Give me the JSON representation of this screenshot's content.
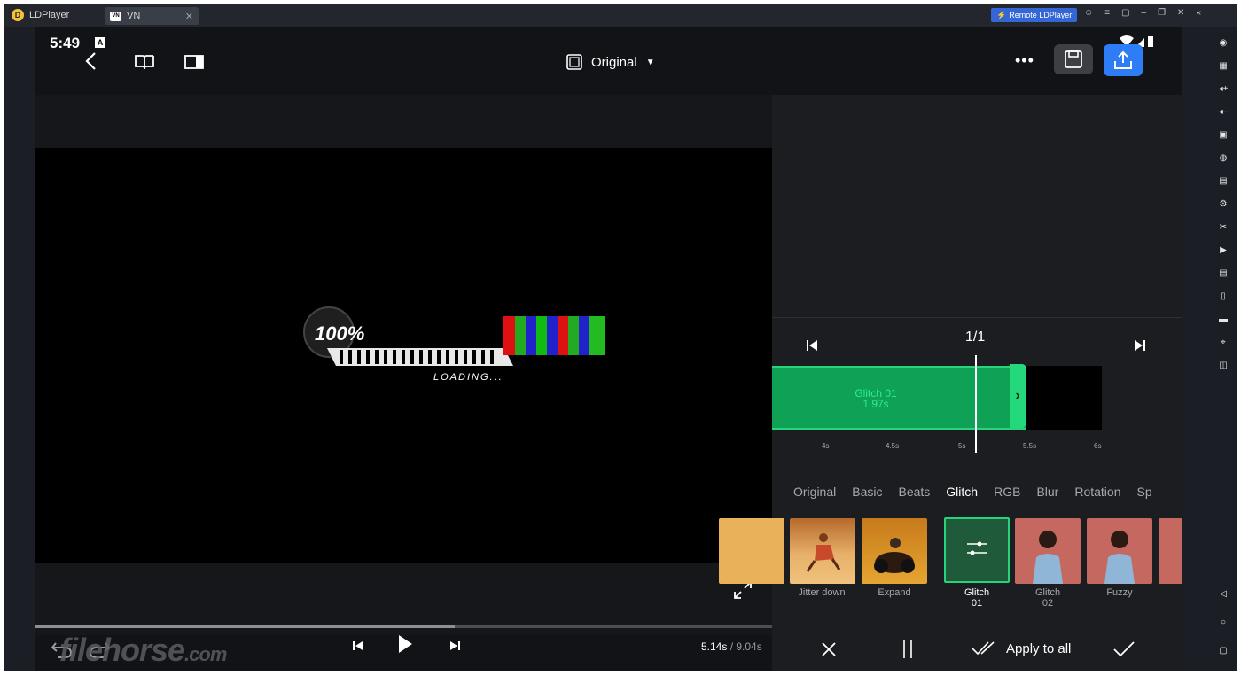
{
  "window": {
    "app_name": "LDPlayer",
    "tab_title": "VN",
    "tab_logo": "VN",
    "remote_button": "Remote LDPlayer"
  },
  "status": {
    "time": "5:49",
    "indicator": "A"
  },
  "topbar": {
    "aspect_label": "Original"
  },
  "preview": {
    "overlay_text": "100%",
    "overlay_subtext": "LOADING...",
    "scrub_progress": 0.57,
    "current_time": "5.14s",
    "total_time": "/ 9.04s"
  },
  "timeline": {
    "page": "1/1",
    "clip_name": "Glitch 01",
    "clip_duration": "1.97s",
    "ruler_labels": [
      "4s",
      "4.5s",
      "5s",
      "5.5s",
      "6s"
    ]
  },
  "effects": {
    "tabs": [
      "Original",
      "Basic",
      "Beats",
      "Glitch",
      "RGB",
      "Blur",
      "Rotation",
      "Sp"
    ],
    "active_tab": "Glitch",
    "items": [
      {
        "label": "Jitter down"
      },
      {
        "label": "Expand"
      },
      {
        "label": "Glitch\n01"
      },
      {
        "label": "Glitch\n02"
      },
      {
        "label": "Fuzzy"
      }
    ]
  },
  "actions": {
    "apply_all": "Apply to all"
  },
  "watermark": {
    "text": "filehorse",
    "suffix": ".com"
  },
  "colors": {
    "accent_blue": "#2e7cf6",
    "clip_green": "#0fa257",
    "selected_green": "#27d37b"
  }
}
